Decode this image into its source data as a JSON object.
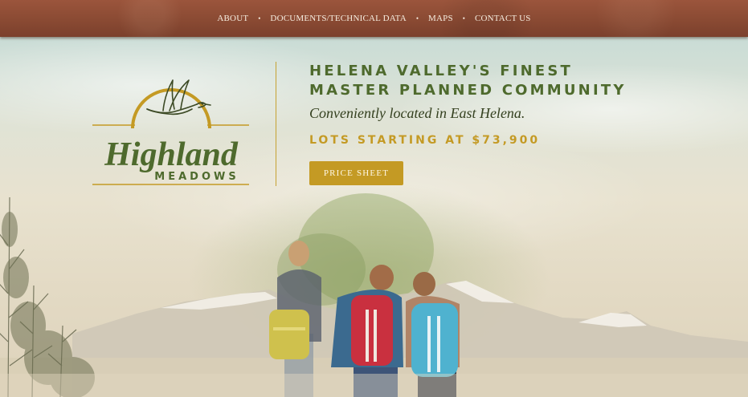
{
  "nav": {
    "items": [
      {
        "label": "ABOUT"
      },
      {
        "label": "DOCUMENTS/TECHNICAL DATA"
      },
      {
        "label": "MAPS"
      },
      {
        "label": "CONTACT US"
      }
    ],
    "separator": "•"
  },
  "logo": {
    "name_script": "Highland",
    "name_caps": "MEADOWS"
  },
  "hero": {
    "headline_line1": "HELENA VALLEY'S FINEST",
    "headline_line2": "MASTER PLANNED COMMUNITY",
    "tagline": "Conveniently located in East Helena.",
    "price_text": "LOTS STARTING AT $73,900",
    "cta_label": "PRICE SHEET"
  },
  "colors": {
    "nav_bg": "#8a4a33",
    "gold": "#c49a24",
    "olive": "#4e6a2d",
    "dark_olive": "#34401f"
  }
}
